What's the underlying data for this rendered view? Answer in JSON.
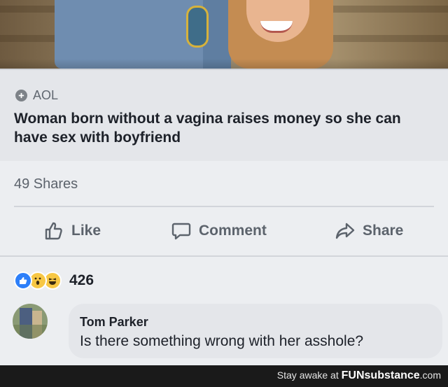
{
  "post": {
    "source": "AOL",
    "source_icon": "globe-icon",
    "headline": "Woman born without a vagina raises money so she can have sex with boyfriend",
    "shares": "49 Shares"
  },
  "actions": {
    "like": "Like",
    "comment": "Comment",
    "share": "Share"
  },
  "reactions": {
    "icons": [
      "like-reaction-icon",
      "wow-reaction-icon",
      "haha-reaction-icon"
    ],
    "count": "426"
  },
  "comment": {
    "author": "Tom Parker",
    "text": "Is there something wrong with her asshole?"
  },
  "watermark": {
    "prefix": "Stay awake at",
    "brand_bold": "FUN",
    "brand_rest": "substance",
    "domain": ".com"
  },
  "colors": {
    "like_blue": "#2d7ff9",
    "reaction_yellow": "#f7c744",
    "text_dark": "#1d2129",
    "text_gray": "#5c636c"
  }
}
